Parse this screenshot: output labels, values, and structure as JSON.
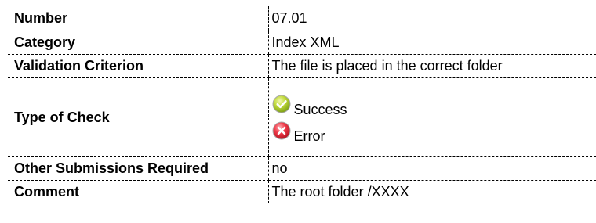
{
  "rows": [
    {
      "label": "Number",
      "value": "07.01"
    },
    {
      "label": "Category",
      "value": "Index XML"
    },
    {
      "label": "Validation Criterion",
      "value": "The file is placed in the correct folder"
    },
    {
      "label": "Type of Check",
      "checks": [
        {
          "icon": "success-check-icon",
          "color": "#9cbf1e",
          "label": "Success"
        },
        {
          "icon": "error-x-icon",
          "color": "#e0283a",
          "label": "Error"
        }
      ]
    },
    {
      "label": "Other Submissions Required",
      "value": "no"
    },
    {
      "label": "Comment",
      "value": "The root folder /XXXX"
    }
  ]
}
